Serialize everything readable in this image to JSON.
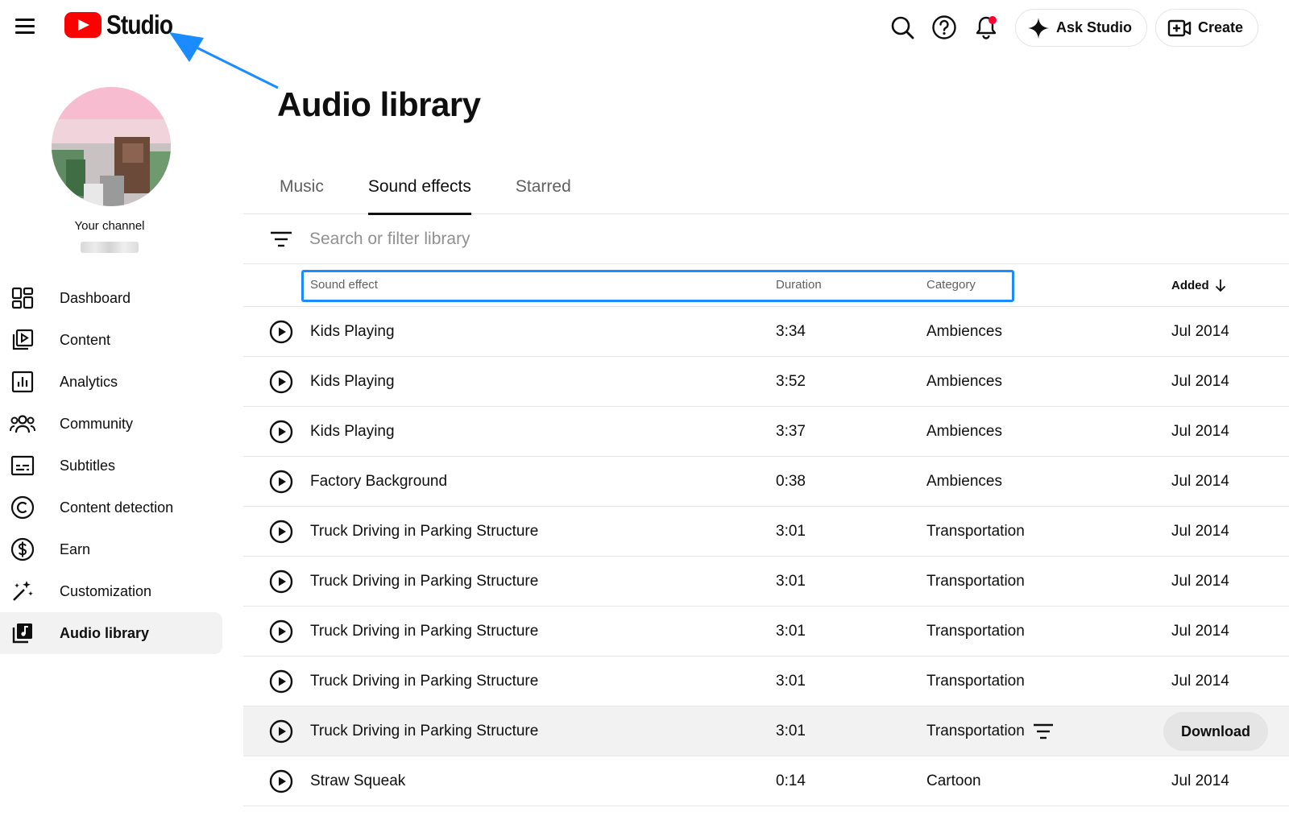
{
  "app": {
    "logo_text": "Studio"
  },
  "header": {
    "icons": [
      "menu-icon",
      "search-icon",
      "help-icon",
      "notifications-icon"
    ],
    "ask_studio_label": "Ask Studio",
    "create_label": "Create",
    "accent": "#ff0000",
    "annotation_arrow_color": "#1a8cff"
  },
  "sidebar": {
    "channel_label": "Your channel",
    "items": [
      {
        "label": "Dashboard",
        "icon": "dashboard-icon"
      },
      {
        "label": "Content",
        "icon": "content-icon"
      },
      {
        "label": "Analytics",
        "icon": "analytics-icon"
      },
      {
        "label": "Community",
        "icon": "community-icon"
      },
      {
        "label": "Subtitles",
        "icon": "subtitles-icon"
      },
      {
        "label": "Content detection",
        "icon": "copyright-icon"
      },
      {
        "label": "Earn",
        "icon": "dollar-icon"
      },
      {
        "label": "Customization",
        "icon": "magic-wand-icon"
      },
      {
        "label": "Audio library",
        "icon": "audio-library-icon",
        "active": true
      }
    ]
  },
  "main": {
    "title": "Audio library",
    "tabs": [
      {
        "label": "Music",
        "active": false
      },
      {
        "label": "Sound effects",
        "active": true
      },
      {
        "label": "Starred",
        "active": false
      }
    ],
    "search": {
      "placeholder": "Search or filter library",
      "value": ""
    },
    "table": {
      "columns": {
        "sound_effect": "Sound effect",
        "duration": "Duration",
        "category": "Category",
        "added": "Added"
      },
      "sort": {
        "column": "Added",
        "direction": "descending"
      },
      "rows": [
        {
          "name": "Kids Playing",
          "duration": "3:34",
          "category": "Ambiences",
          "added": "Jul 2014"
        },
        {
          "name": "Kids Playing",
          "duration": "3:52",
          "category": "Ambiences",
          "added": "Jul 2014"
        },
        {
          "name": "Kids Playing",
          "duration": "3:37",
          "category": "Ambiences",
          "added": "Jul 2014"
        },
        {
          "name": "Factory Background",
          "duration": "0:38",
          "category": "Ambiences",
          "added": "Jul 2014"
        },
        {
          "name": "Truck Driving in Parking Structure",
          "duration": "3:01",
          "category": "Transportation",
          "added": "Jul 2014"
        },
        {
          "name": "Truck Driving in Parking Structure",
          "duration": "3:01",
          "category": "Transportation",
          "added": "Jul 2014"
        },
        {
          "name": "Truck Driving in Parking Structure",
          "duration": "3:01",
          "category": "Transportation",
          "added": "Jul 2014"
        },
        {
          "name": "Truck Driving in Parking Structure",
          "duration": "3:01",
          "category": "Transportation",
          "added": "Jul 2014"
        },
        {
          "name": "Truck Driving in Parking Structure",
          "duration": "3:01",
          "category": "Transportation",
          "added": "",
          "hovered": true,
          "action_label": "Download"
        },
        {
          "name": "Straw Squeak",
          "duration": "0:14",
          "category": "Cartoon",
          "added": "Jul 2014"
        }
      ]
    }
  }
}
